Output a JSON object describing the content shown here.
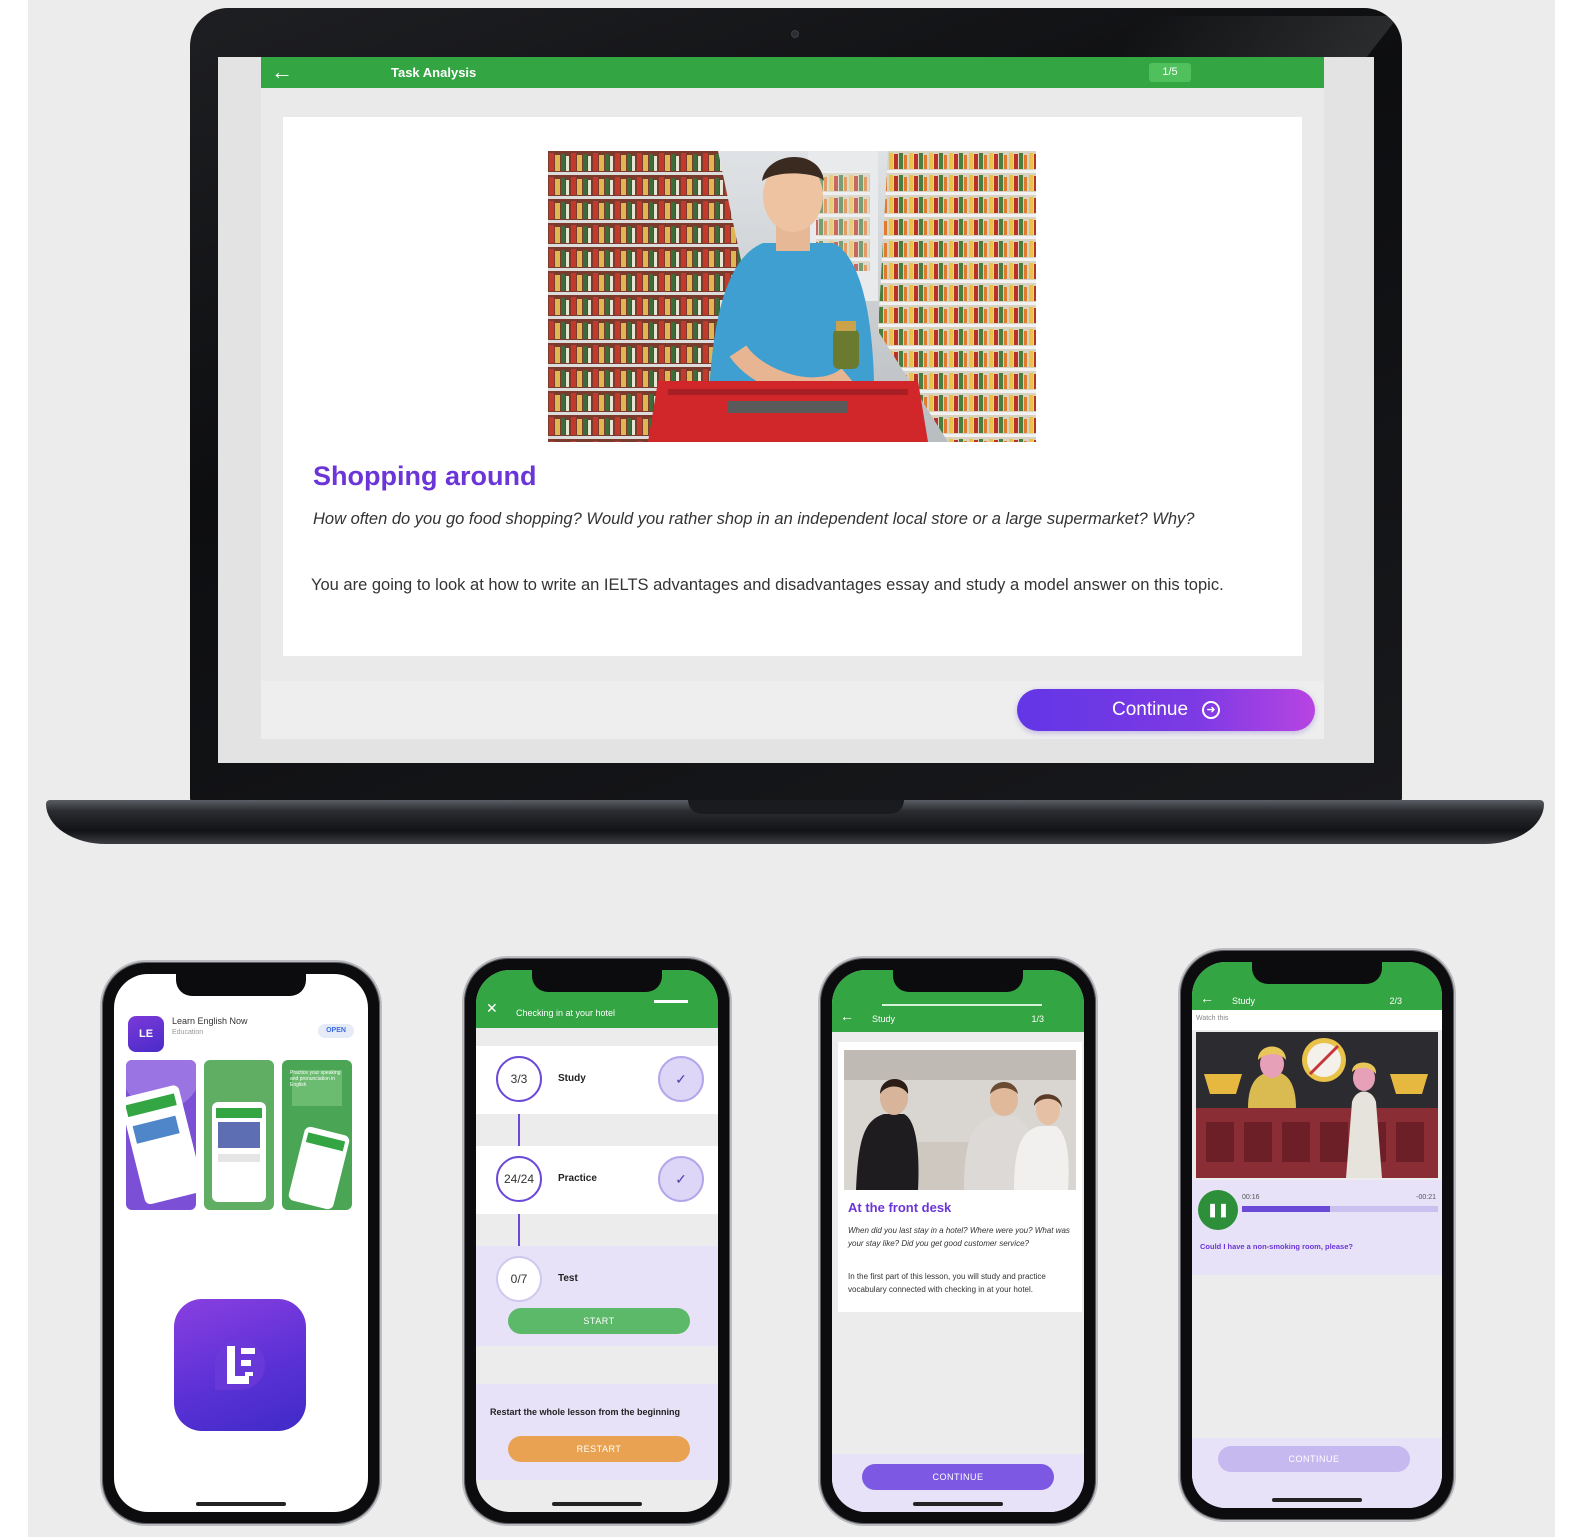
{
  "laptop": {
    "app_bar": {
      "back_icon": "arrow-left-icon",
      "title": "Task Analysis",
      "progress": "1/5"
    },
    "lesson": {
      "image_description_icon": "supermarket-photo",
      "title": "Shopping around",
      "question": "How often do you go food shopping? Would you rather shop in an independent local store or a large supermarket? Why?",
      "body": "You are going to look at how to write an IELTS advantages and disadvantages essay and study a model answer on this topic."
    },
    "continue_label": "Continue",
    "continue_icon": "arrow-right-circle-icon"
  },
  "phone1": {
    "app_name": "Learn English Now",
    "app_category": "Education",
    "open_label": "OPEN",
    "shot_caption": "Practice your speaking and pronunciation in English",
    "icon_glyph": "LE"
  },
  "phone2": {
    "header_title": "Checking in at your hotel",
    "close_icon": "close-icon",
    "steps": [
      {
        "count": "3/3",
        "label": "Study"
      },
      {
        "count": "24/24",
        "label": "Practice"
      },
      {
        "count": "0/7",
        "label": "Test"
      }
    ],
    "start_label": "START",
    "restart_text": "Restart the whole lesson from the beginning",
    "restart_label": "RESTART"
  },
  "phone3": {
    "header_title": "Study",
    "progress": "1/3",
    "title": "At the front desk",
    "question": "When did you last stay in a hotel? Where were you? What was your stay like? Did you get good customer service?",
    "body": "In the first part of this lesson, you will study and practice vocabulary connected with checking in at your hotel.",
    "continue_label": "CONTINUE"
  },
  "phone4": {
    "header_title": "Study",
    "progress": "2/3",
    "instruction": "Watch this",
    "time_elapsed": "00:16",
    "time_remaining": "-00:21",
    "playback_fraction": 0.45,
    "caption": "Could I have a non-smoking room, please?",
    "continue_label": "CONTINUE"
  },
  "colors": {
    "green": "#33a542",
    "purple": "#6b35d8",
    "orange": "#e9a252",
    "lavender": "#e7e2f8"
  }
}
